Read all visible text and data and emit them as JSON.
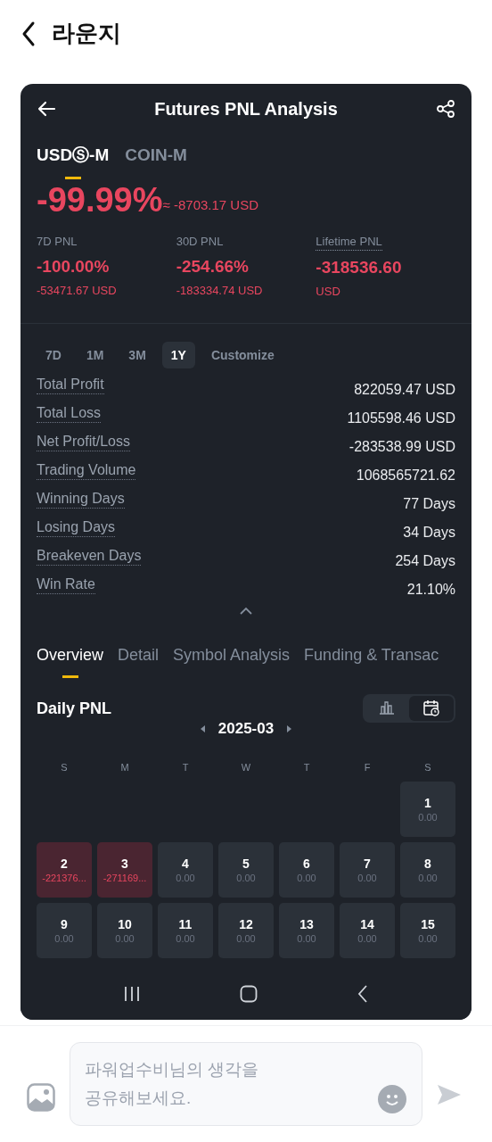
{
  "header": {
    "title": "라운지"
  },
  "card": {
    "title": "Futures PNL Analysis",
    "tabs": [
      {
        "label": "USDⓈ-M",
        "selected": true
      },
      {
        "label": "COIN-M",
        "selected": false
      }
    ],
    "headline": {
      "percent": "-99.99%",
      "approx": "≈ -8703.17 USD"
    },
    "summary": [
      {
        "label": "7D PNL",
        "dotted": false,
        "value": "-100.00%",
        "amount": "-53471.67 USD"
      },
      {
        "label": "30D PNL",
        "dotted": false,
        "value": "-254.66%",
        "amount": "-183334.74 USD"
      },
      {
        "label": "Lifetime PNL",
        "dotted": true,
        "value": "-318536.60",
        "amount": "USD"
      }
    ],
    "periods": [
      {
        "label": "7D",
        "selected": false
      },
      {
        "label": "1M",
        "selected": false
      },
      {
        "label": "3M",
        "selected": false
      },
      {
        "label": "1Y",
        "selected": true
      },
      {
        "label": "Customize",
        "selected": false
      }
    ],
    "metrics": [
      {
        "label": "Total Profit",
        "value": "822059.47 USD"
      },
      {
        "label": "Total Loss",
        "value": "1105598.46 USD"
      },
      {
        "label": "Net Profit/Loss",
        "value": "-283538.99 USD"
      },
      {
        "label": "Trading Volume",
        "value": "1068565721.62"
      },
      {
        "label": "Winning Days",
        "value": "77 Days"
      },
      {
        "label": "Losing Days",
        "value": "34 Days"
      },
      {
        "label": "Breakeven Days",
        "value": "254 Days"
      },
      {
        "label": "Win Rate",
        "value": "21.10%"
      }
    ],
    "sections": [
      {
        "label": "Overview",
        "selected": true
      },
      {
        "label": "Detail",
        "selected": false
      },
      {
        "label": "Symbol Analysis",
        "selected": false
      },
      {
        "label": "Funding & Transac",
        "selected": false
      }
    ],
    "daily": {
      "title": "Daily PNL",
      "month": "2025-03",
      "views": [
        {
          "kind": "bar",
          "selected": false
        },
        {
          "kind": "calendar",
          "selected": true
        }
      ],
      "weekdays": [
        "S",
        "M",
        "T",
        "W",
        "T",
        "F",
        "S"
      ],
      "weeks": [
        [
          {
            "day": "1",
            "pnl": "0.00",
            "loss": false
          }
        ],
        [
          {
            "day": "2",
            "pnl": "-221376...",
            "loss": true
          },
          {
            "day": "3",
            "pnl": "-271169...",
            "loss": true
          },
          {
            "day": "4",
            "pnl": "0.00",
            "loss": false
          },
          {
            "day": "5",
            "pnl": "0.00",
            "loss": false
          },
          {
            "day": "6",
            "pnl": "0.00",
            "loss": false
          },
          {
            "day": "7",
            "pnl": "0.00",
            "loss": false
          },
          {
            "day": "8",
            "pnl": "0.00",
            "loss": false
          }
        ],
        [
          {
            "day": "9",
            "pnl": "0.00",
            "loss": false
          },
          {
            "day": "10",
            "pnl": "0.00",
            "loss": false
          },
          {
            "day": "11",
            "pnl": "0.00",
            "loss": false
          },
          {
            "day": "12",
            "pnl": "0.00",
            "loss": false
          },
          {
            "day": "13",
            "pnl": "0.00",
            "loss": false
          },
          {
            "day": "14",
            "pnl": "0.00",
            "loss": false
          },
          {
            "day": "15",
            "pnl": "0.00",
            "loss": false
          }
        ]
      ]
    }
  },
  "composer": {
    "placeholder": "파워업수비님의 생각을\n공유해보세요."
  }
}
